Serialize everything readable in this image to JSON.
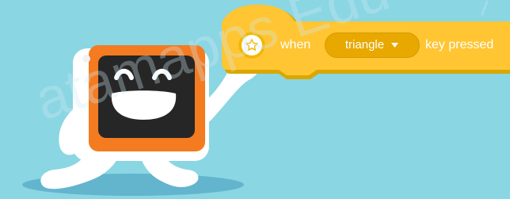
{
  "block": {
    "event_icon": "star-icon",
    "prefix_text": "when",
    "selected_key": "triangle",
    "dropdown_icon": "triangle-down-icon",
    "suffix_text": "key pressed"
  },
  "mascot": {
    "name": "robot-mascot"
  },
  "watermark": {
    "text": "atamapps Edu"
  },
  "colors": {
    "background": "#8AD6E3",
    "block_yellow": "#FFC533",
    "block_shadow": "#D9A700",
    "dropdown_fill": "#E8A800",
    "robot_orange": "#F47B20",
    "robot_face": "#262626",
    "robot_body": "#FFFFFF"
  }
}
